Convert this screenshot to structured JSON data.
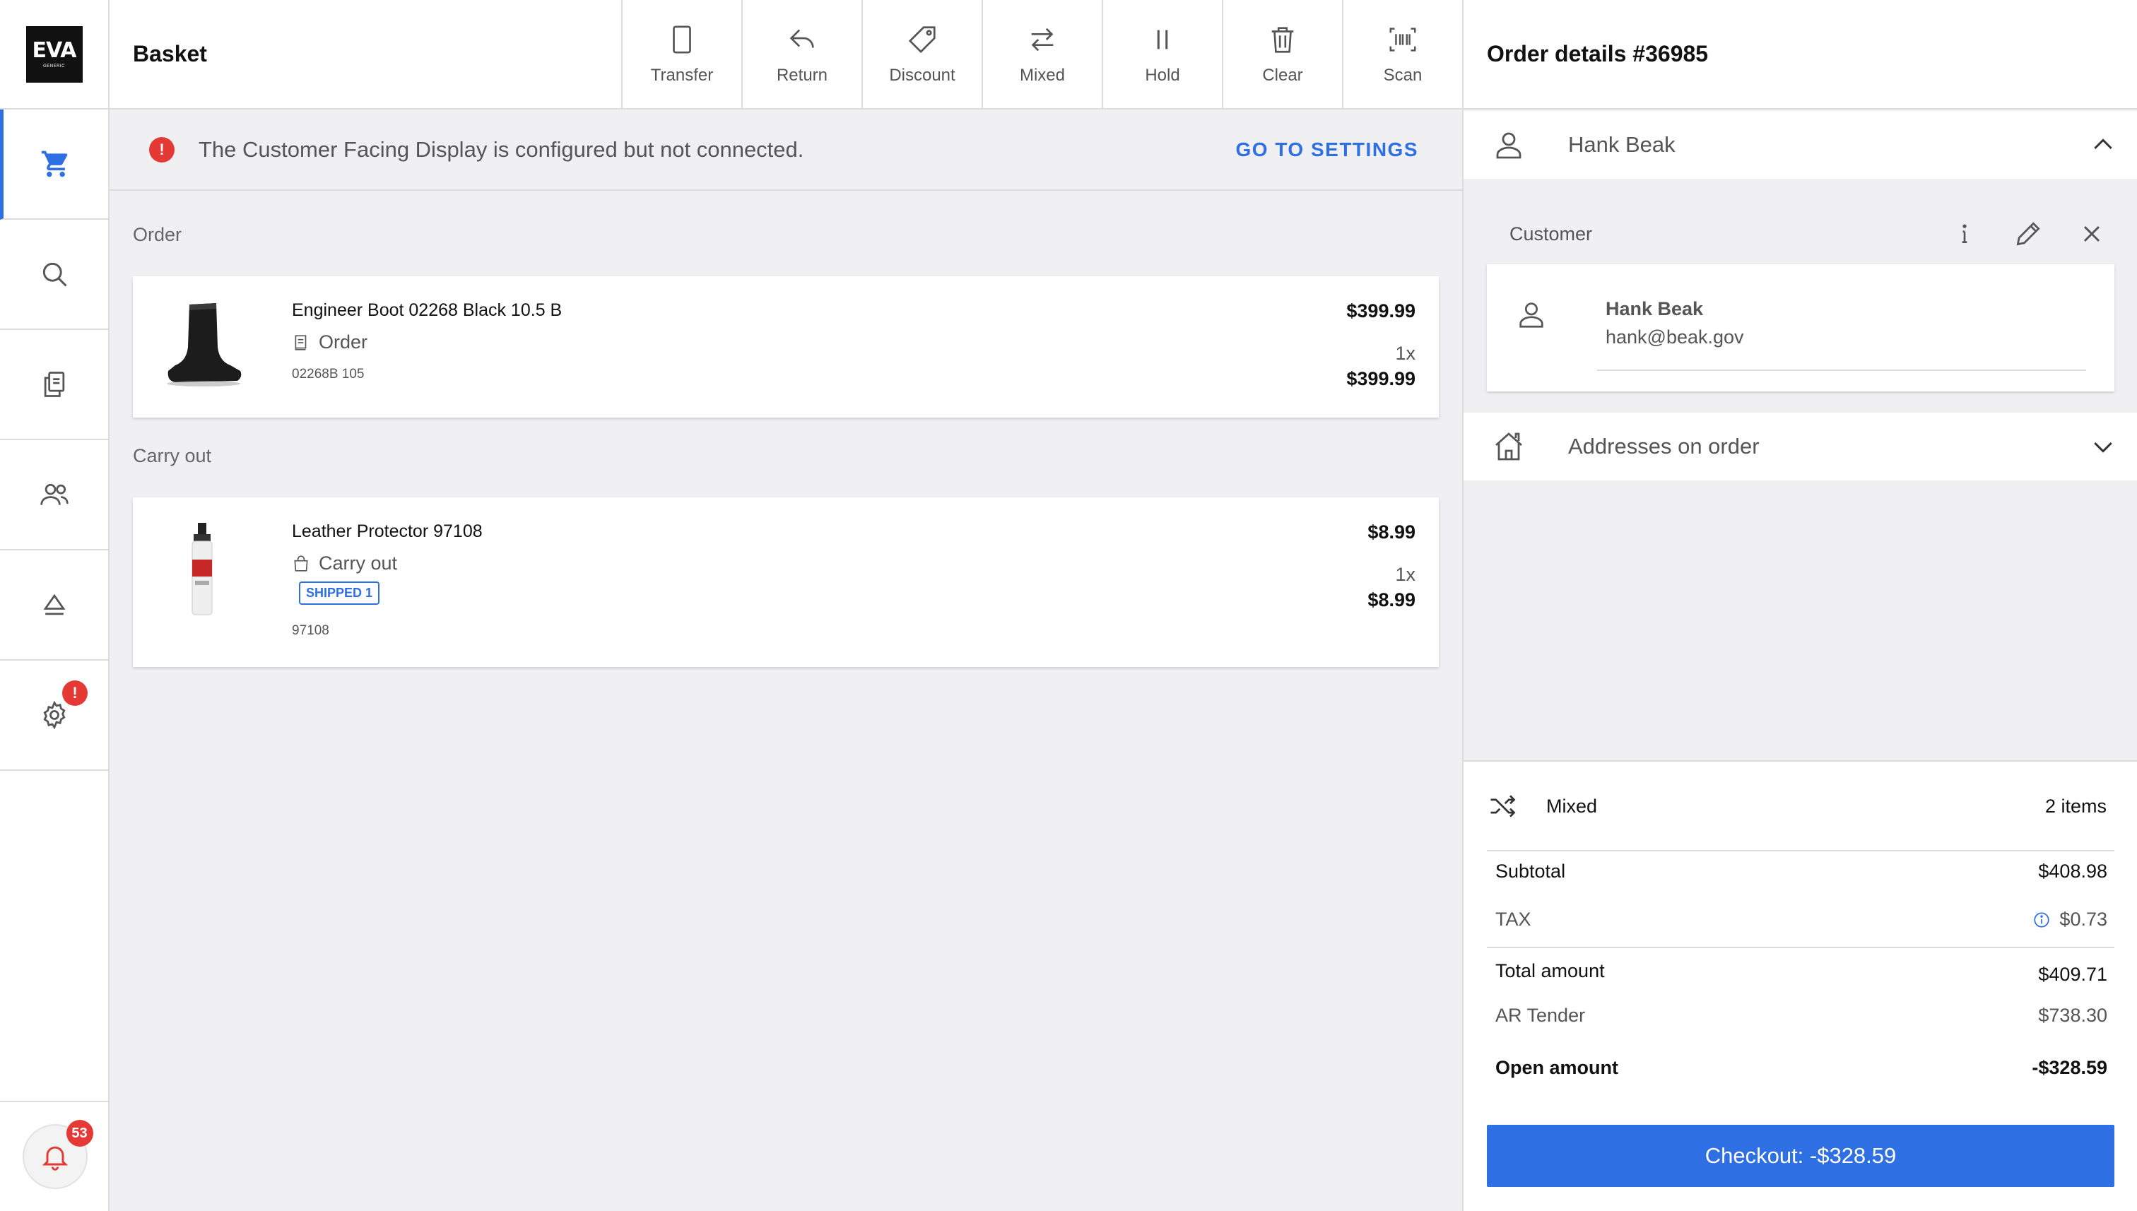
{
  "app": {
    "logo_text": "EVA",
    "logo_sub": "GENERIC"
  },
  "sidebar": {
    "notification_count": "53",
    "settings_badge": "!"
  },
  "toolbar": {
    "title": "Basket",
    "actions": [
      {
        "label": "Transfer",
        "icon": "tablet-icon"
      },
      {
        "label": "Return",
        "icon": "return-icon"
      },
      {
        "label": "Discount",
        "icon": "tag-icon"
      },
      {
        "label": "Mixed",
        "icon": "swap-icon"
      },
      {
        "label": "Hold",
        "icon": "pause-icon"
      },
      {
        "label": "Clear",
        "icon": "trash-icon"
      },
      {
        "label": "Scan",
        "icon": "barcode-icon"
      }
    ]
  },
  "alert": {
    "icon": "!",
    "message": "The Customer Facing Display is configured but not connected.",
    "action": "GO TO SETTINGS"
  },
  "sections": [
    {
      "label": "Order",
      "items": [
        {
          "name": "Engineer Boot 02268 Black 10.5 B",
          "type": "Order",
          "sku": "02268B 105",
          "unit_price": "$399.99",
          "quantity": "1x",
          "total": "$399.99"
        }
      ]
    },
    {
      "label": "Carry out",
      "items": [
        {
          "name": "Leather Protector 97108",
          "type": "Carry out",
          "badge": "SHIPPED 1",
          "sku": "97108",
          "unit_price": "$8.99",
          "quantity": "1x",
          "total": "$8.99"
        }
      ]
    }
  ],
  "order_details": {
    "title": "Order details #36985",
    "customer_name": "Hank Beak",
    "customer_section_label": "Customer",
    "customer": {
      "name": "Hank Beak",
      "email": "hank@beak.gov"
    },
    "addresses_label": "Addresses on order"
  },
  "summary": {
    "mode": "Mixed",
    "item_count": "2 items",
    "subtotal_label": "Subtotal",
    "subtotal": "$408.98",
    "tax_label": "TAX",
    "tax": "$0.73",
    "total_label": "Total amount",
    "total": "$409.71",
    "tender_label": "AR Tender",
    "tender": "$738.30",
    "open_label": "Open amount",
    "open": "-$328.59",
    "checkout": "Checkout: -$328.59"
  },
  "colors": {
    "accent": "#2f6fe4",
    "alert": "#e53935"
  }
}
